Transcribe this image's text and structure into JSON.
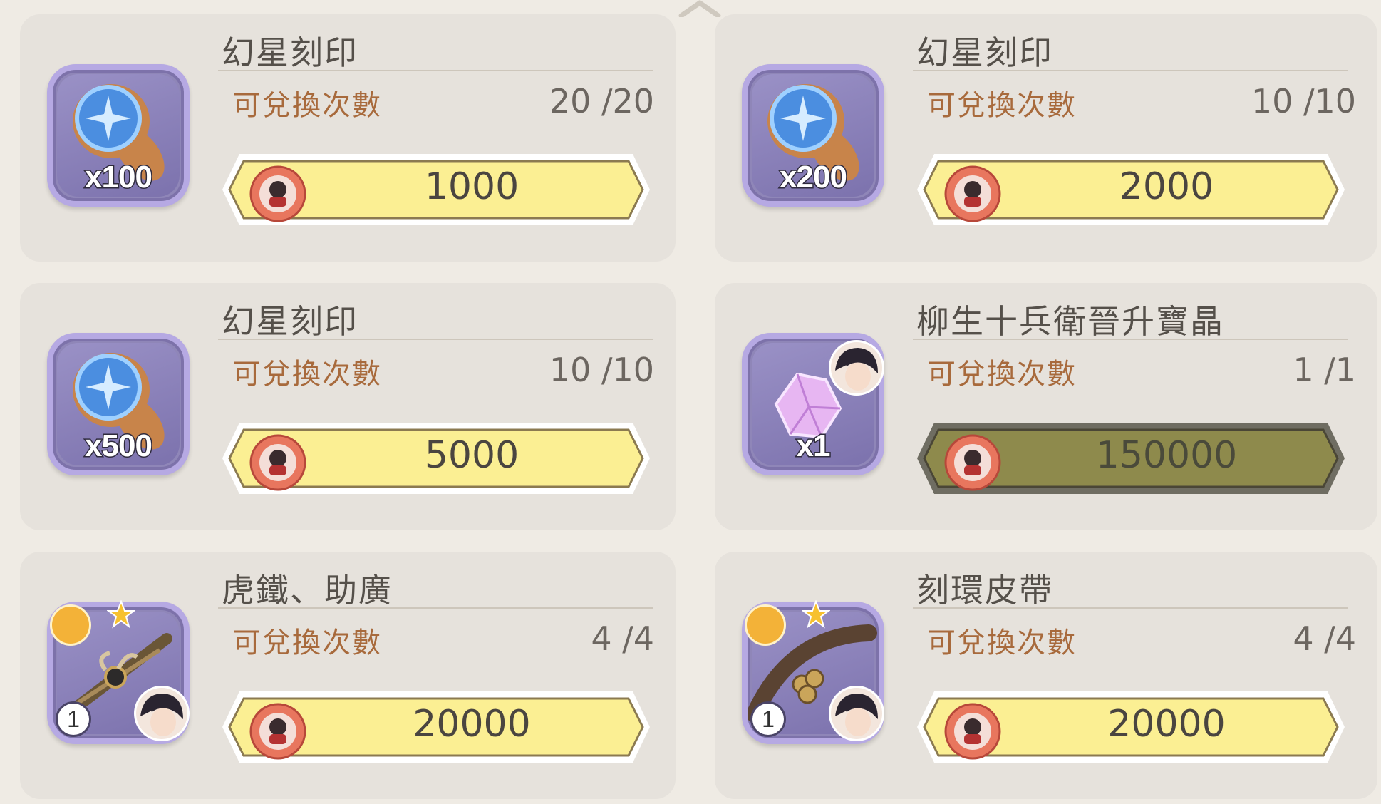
{
  "scroll_up_icon": "chevron-up-icon",
  "count_label": "可兌換次數",
  "colors": {
    "card_bg": "#e6e2dc",
    "button_yellow": "#fbef93",
    "button_disabled": "#8e8a4c",
    "label_brown": "#a86a3c",
    "icon_frame": "#8f86b8"
  },
  "items": [
    {
      "title": "幻星刻印",
      "icon": "stamp-icon",
      "quantity": "x100",
      "count": "20 /20",
      "price": "1000",
      "currency_icon": "coin-icon",
      "disabled": false
    },
    {
      "title": "幻星刻印",
      "icon": "stamp-icon",
      "quantity": "x200",
      "count": "10 /10",
      "price": "2000",
      "currency_icon": "coin-icon",
      "disabled": false
    },
    {
      "title": "幻星刻印",
      "icon": "stamp-icon",
      "quantity": "x500",
      "count": "10 /10",
      "price": "5000",
      "currency_icon": "coin-icon",
      "disabled": false
    },
    {
      "title": "柳生十兵衛晉升寶晶",
      "icon": "crystal-icon",
      "quantity": "x1",
      "count": "1 /1",
      "price": "150000",
      "currency_icon": "coin-icon",
      "disabled": true
    },
    {
      "title": "虎鐵、助廣",
      "icon": "katana-icon",
      "quantity": "",
      "level": "1",
      "count": "4 /4",
      "price": "20000",
      "currency_icon": "coin-icon",
      "disabled": false
    },
    {
      "title": "刻環皮帶",
      "icon": "belt-icon",
      "quantity": "",
      "level": "1",
      "count": "4 /4",
      "price": "20000",
      "currency_icon": "coin-icon",
      "disabled": false
    }
  ]
}
